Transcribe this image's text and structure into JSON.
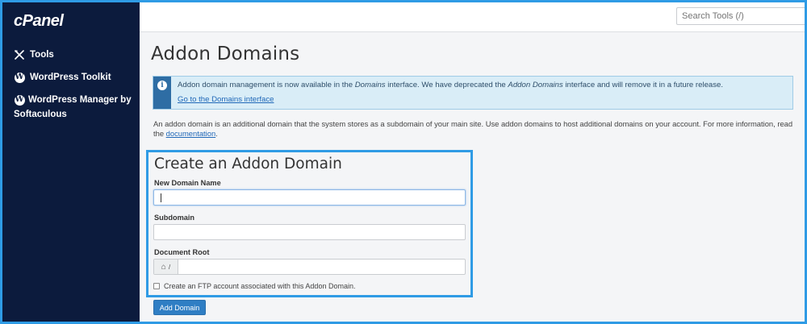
{
  "app": {
    "logo_text": "cPanel"
  },
  "sidebar": {
    "items": [
      {
        "label": "Tools",
        "icon": "tools-icon"
      },
      {
        "label": "WordPress Toolkit",
        "icon": "wordpress-icon"
      },
      {
        "label": "WordPress Manager by Softaculous",
        "icon": "wordpress-icon"
      }
    ]
  },
  "topbar": {
    "search_placeholder": "Search Tools (/)"
  },
  "page": {
    "title": "Addon Domains",
    "alert": {
      "text_1": "Addon domain management is now available in the ",
      "text_em_1": "Domains",
      "text_2": " interface. We have deprecated the ",
      "text_em_2": "Addon Domains",
      "text_3": " interface and will remove it in a future release.",
      "link": "Go to the Domains interface"
    },
    "description": "An addon domain is an additional domain that the system stores as a subdomain of your main site. Use addon domains to host additional domains on your account. For more information, read the",
    "description_link": "documentation",
    "description_end": "."
  },
  "form": {
    "title": "Create an Addon Domain",
    "new_domain_label": "New Domain Name",
    "new_domain_value": "",
    "subdomain_label": "Subdomain",
    "subdomain_value": "",
    "docroot_label": "Document Root",
    "docroot_prefix": "/",
    "docroot_value": "",
    "ftp_checkbox_label": "Create an FTP account associated with this Addon Domain.",
    "ftp_checked": false,
    "submit_label": "Add Domain"
  },
  "colors": {
    "sidebar_bg": "#0c1b3d",
    "accent": "#2f9be5",
    "button": "#2f7ec4",
    "alert_bg": "#d9edf7"
  }
}
